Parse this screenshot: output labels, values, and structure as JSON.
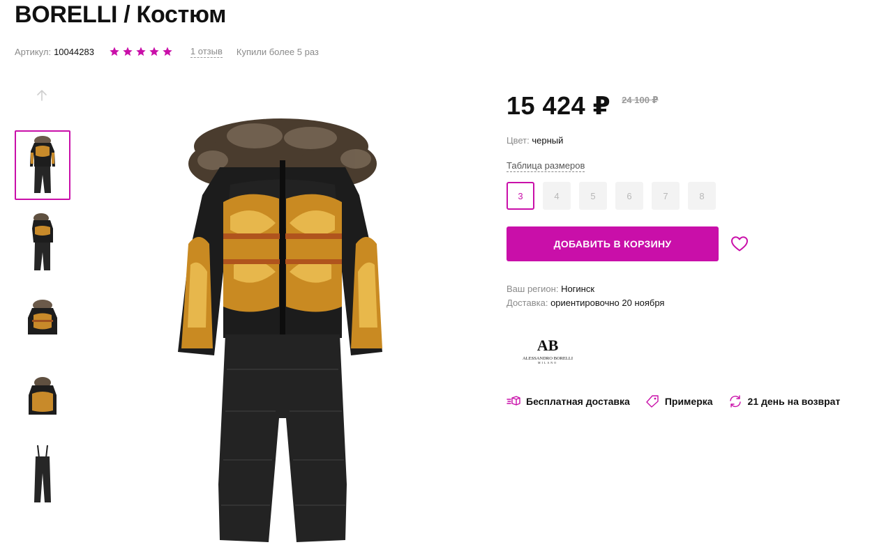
{
  "product": {
    "title": "BORELLI / Костюм",
    "sku_label": "Артикул:",
    "sku": "10044283",
    "rating": 5,
    "reviews": "1 отзыв",
    "bought": "Купили более 5 раз"
  },
  "gallery": {
    "thumbnail_count": 5,
    "active_index": 0
  },
  "pricing": {
    "price": "15 424 ₽",
    "old_price": "24 100 ₽"
  },
  "color": {
    "label": "Цвет:",
    "value": "черный"
  },
  "sizes": {
    "table_link": "Таблица размеров",
    "options": [
      "3",
      "4",
      "5",
      "6",
      "7",
      "8"
    ],
    "selected": "3"
  },
  "actions": {
    "add_to_cart": "ДОБАВИТЬ В КОРЗИНУ"
  },
  "delivery": {
    "region_label": "Ваш регион:",
    "region_value": "Ногинск",
    "delivery_label": "Доставка:",
    "delivery_value": "ориентировочно 20 ноября"
  },
  "brand": {
    "logo_monogram": "AB",
    "logo_name": "ALESSANDRO BORELLI",
    "logo_city": "MILANO"
  },
  "features": [
    {
      "icon": "delivery-box-icon",
      "label": "Бесплатная доставка"
    },
    {
      "icon": "tag-icon",
      "label": "Примерка"
    },
    {
      "icon": "return-arrows-icon",
      "label": "21 день на возврат"
    }
  ],
  "colors": {
    "accent": "#c90fa9",
    "text": "#111111",
    "muted": "#8a8a8a"
  }
}
